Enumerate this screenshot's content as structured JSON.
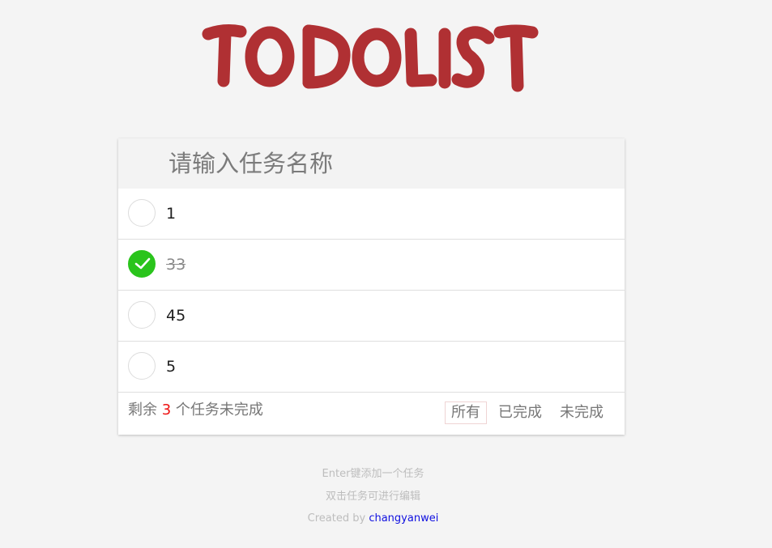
{
  "header": {
    "logo_text": "TODOLIST",
    "logo_color": "#b03033"
  },
  "new_todo": {
    "placeholder": "请输入任务名称",
    "value": ""
  },
  "todos": [
    {
      "label": "1",
      "completed": false
    },
    {
      "label": "33",
      "completed": true
    },
    {
      "label": "45",
      "completed": false
    },
    {
      "label": "5",
      "completed": false
    }
  ],
  "footer": {
    "count_prefix": "剩余",
    "count_value": "3",
    "count_suffix": "个任务未完成",
    "filters": [
      {
        "label": "所有",
        "selected": true
      },
      {
        "label": "已完成",
        "selected": false
      },
      {
        "label": "未完成",
        "selected": false
      }
    ]
  },
  "info": {
    "line1": "Enter键添加一个任务",
    "line2": "双击任务可进行编辑",
    "created_by": "Created by",
    "author": "changyanwei"
  },
  "colors": {
    "check_green": "#2ac41c",
    "count_red": "#ee1111",
    "link_blue": "#1010e0"
  }
}
